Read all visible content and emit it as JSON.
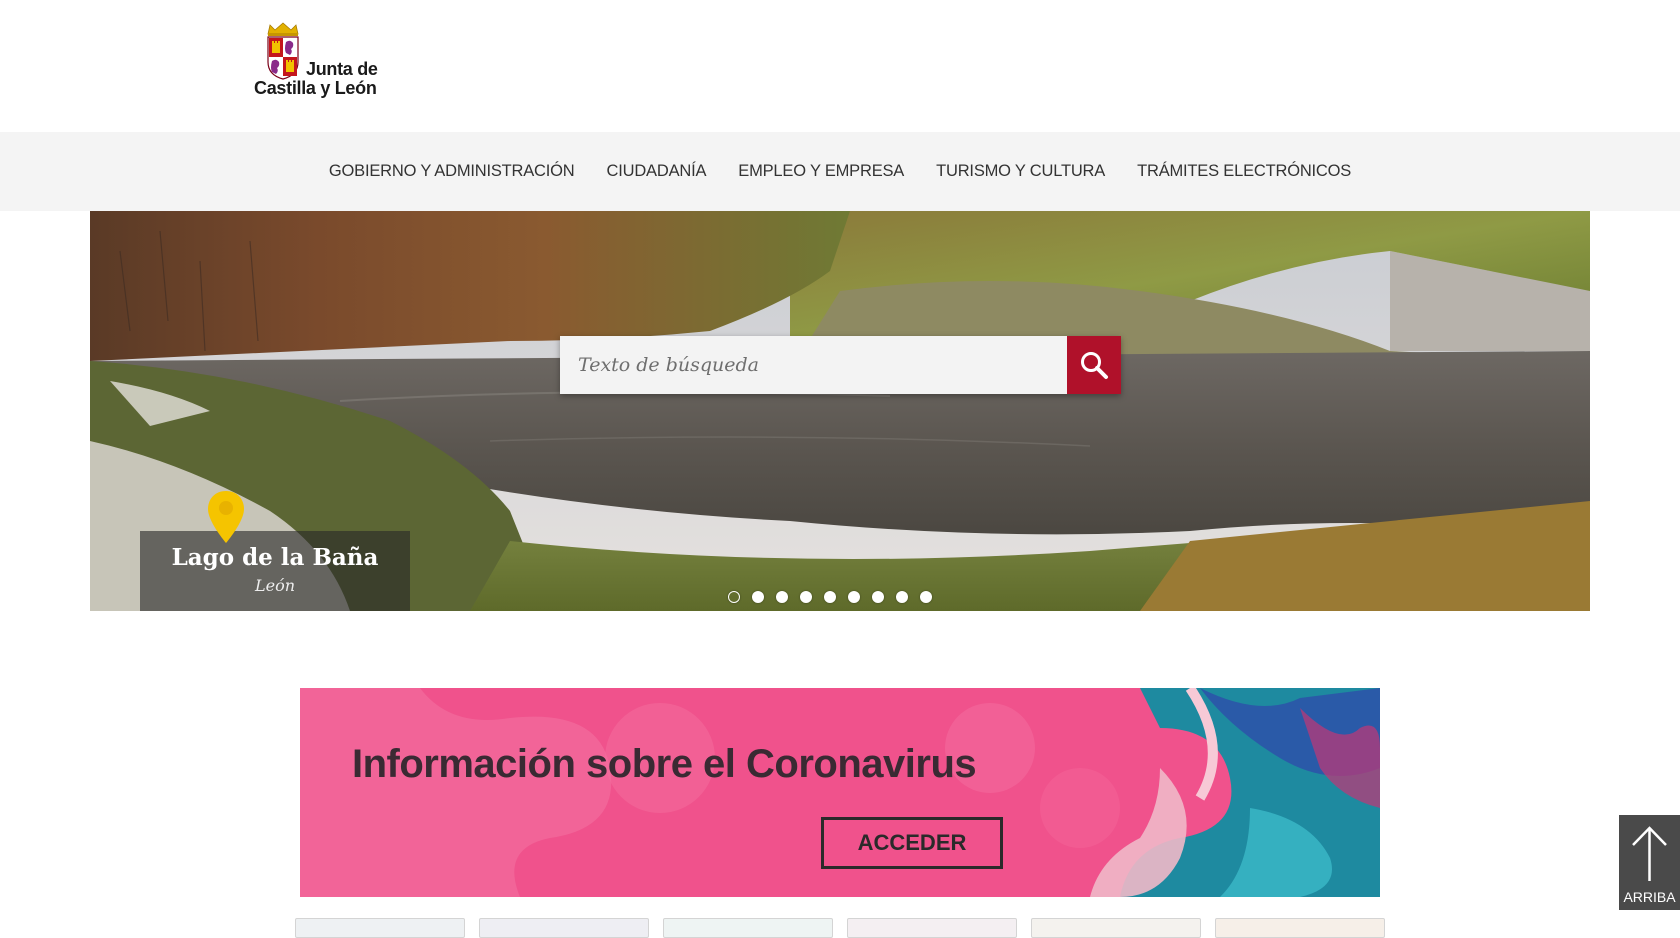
{
  "header": {
    "logo_line1": "Junta de",
    "logo_line2": "Castilla y León"
  },
  "nav": {
    "items": [
      {
        "label": "GOBIERNO Y ADMINISTRACIÓN"
      },
      {
        "label": "CIUDADANÍA"
      },
      {
        "label": "EMPLEO Y EMPRESA"
      },
      {
        "label": "TURISMO Y CULTURA"
      },
      {
        "label": "TRÁMITES ELECTRÓNICOS"
      }
    ]
  },
  "hero": {
    "search_placeholder": "Texto de búsqueda",
    "search_icon": "magnifier-icon",
    "caption_icon": "location-pin-icon",
    "caption_title": "Lago de la Baña",
    "caption_subtitle": "León",
    "slides_total": 9,
    "active_slide": 1
  },
  "banner": {
    "title": "Información sobre el Coronavirus",
    "button_label": "ACCEDER"
  },
  "back_to_top": {
    "label": "ARRIBA",
    "icon": "arrow-up-icon"
  },
  "colors": {
    "accent": "#b0112a",
    "nav_bg": "#f4f4f4",
    "banner_pink": "#f0528c",
    "pin_yellow": "#f5c400"
  }
}
